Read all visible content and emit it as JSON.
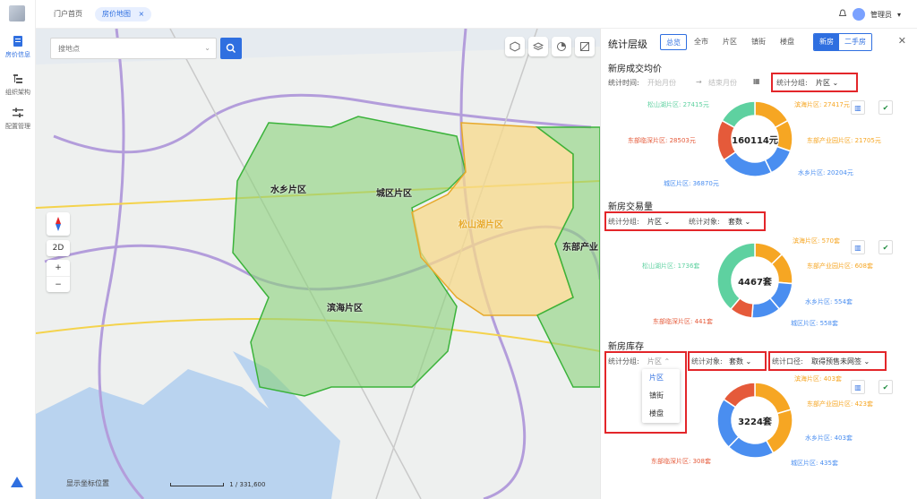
{
  "sidebar": {
    "items": [
      {
        "label": "房价信息",
        "active": true
      },
      {
        "label": "组织架构",
        "active": false
      },
      {
        "label": "配置管理",
        "active": false
      }
    ]
  },
  "tabs": [
    {
      "label": "门户首页"
    },
    {
      "label": "房价地图"
    }
  ],
  "user": {
    "name": "管理员"
  },
  "map": {
    "search_placeholder": "搜地点",
    "regions": [
      {
        "name": "水乡片区",
        "color": "#5fc35a"
      },
      {
        "name": "城区片区",
        "color": "#5fc35a"
      },
      {
        "name": "松山湖片区",
        "color": "#f2b84a"
      },
      {
        "name": "东部产业",
        "color": "#5fc35a"
      },
      {
        "name": "滨海片区",
        "color": "#5fc35a"
      }
    ],
    "view_mode": "2D",
    "coord_label": "显示坐标位置",
    "scale": "1 / 331,600"
  },
  "panel": {
    "title": "统计层级",
    "levels": [
      "总览",
      "全市",
      "片区",
      "镇街",
      "楼盘"
    ],
    "active_level": "总览",
    "toggle": {
      "on": "新房",
      "off": "二手房"
    },
    "section1": {
      "title": "新房成交均价",
      "time_label": "统计时间:",
      "start_placeholder": "开始月份",
      "arrow": "→",
      "end_placeholder": "结束月份",
      "group_label": "统计分组:",
      "group_value": "片区",
      "center": "160114元",
      "labels": {
        "l1": "松山湖片区: 27415元",
        "l2": "滨海片区: 27417元",
        "l3": "东部临深片区: 28503元",
        "l4": "东部产业园片区: 21705元",
        "l5": "水乡片区: 20204元",
        "l6": "城区片区: 36870元"
      }
    },
    "section2": {
      "title": "新房交易量",
      "group_label": "统计分组:",
      "group_value": "片区",
      "target_label": "统计对象:",
      "target_value": "套数",
      "center": "4467套",
      "labels": {
        "l1": "滨海片区: 570套",
        "l2": "东部产业园片区: 608套",
        "l3": "松山湖片区: 1736套",
        "l4": "水乡片区: 554套",
        "l5": "东部临深片区: 441套",
        "l6": "城区片区: 558套"
      }
    },
    "section3": {
      "title": "新房库存",
      "group_label": "统计分组:",
      "group_value": "片区",
      "target_label": "统计对象:",
      "target_value": "套数",
      "caliber_label": "统计口径:",
      "caliber_value": "取得预售未网签",
      "dropdown": [
        "片区",
        "镇街",
        "楼盘"
      ],
      "center": "3224套",
      "labels": {
        "l1": "滨海片区: 403套",
        "l2": "东部产业园片区: 423套",
        "l4": "水乡片区: 403套",
        "l5": "东部临深片区: 308套",
        "l6": "城区片区: 435套"
      }
    }
  },
  "chart_data": [
    {
      "type": "pie",
      "title": "新房成交均价",
      "categories": [
        "滨海片区",
        "东部产业园片区",
        "水乡片区",
        "城区片区",
        "东部临深片区",
        "松山湖片区"
      ],
      "values": [
        27417,
        21705,
        20204,
        36870,
        28503,
        27415
      ],
      "colors": [
        "#f6a623",
        "#f6a623",
        "#4a8ef0",
        "#4a8ef0",
        "#e55a3a",
        "#5ed1a0"
      ],
      "center": "160114元"
    },
    {
      "type": "pie",
      "title": "新房交易量",
      "categories": [
        "滨海片区",
        "东部产业园片区",
        "水乡片区",
        "城区片区",
        "东部临深片区",
        "松山湖片区"
      ],
      "values": [
        570,
        608,
        554,
        558,
        441,
        1736
      ],
      "colors": [
        "#f6a623",
        "#f6a623",
        "#4a8ef0",
        "#4a8ef0",
        "#e55a3a",
        "#5ed1a0"
      ],
      "center": "4467套"
    },
    {
      "type": "pie",
      "title": "新房库存",
      "categories": [
        "滨海片区",
        "东部产业园片区",
        "水乡片区",
        "城区片区",
        "东部临深片区"
      ],
      "values": [
        403,
        423,
        403,
        435,
        308
      ],
      "colors": [
        "#f6a623",
        "#f6a623",
        "#4a8ef0",
        "#4a8ef0",
        "#e55a3a"
      ],
      "center": "3224套"
    }
  ]
}
